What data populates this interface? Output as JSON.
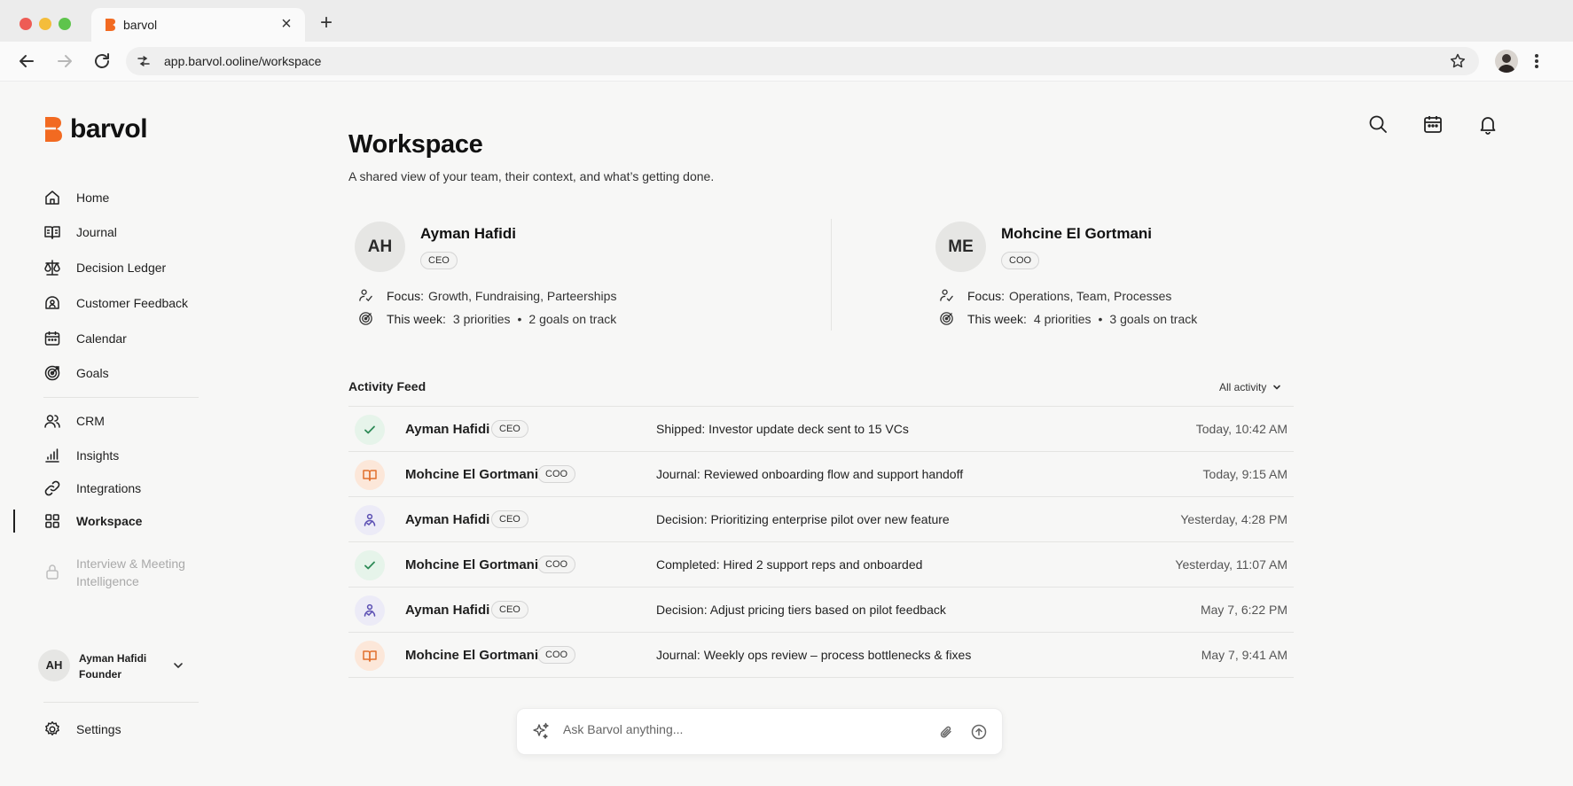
{
  "browser": {
    "tab_title": "barvol",
    "url": "app.barvol.ooline/workspace"
  },
  "brand": {
    "name": "barvol",
    "accent": "#f26a21"
  },
  "sidebar": {
    "items": [
      {
        "label": "Home",
        "icon": "home-icon"
      },
      {
        "label": "Journal",
        "icon": "book-icon"
      },
      {
        "label": "Decision Ledger",
        "icon": "scale-icon"
      },
      {
        "label": "Customer Feedback",
        "icon": "feedback-icon"
      },
      {
        "label": "Calendar",
        "icon": "calendar-icon"
      },
      {
        "label": "Goals",
        "icon": "target-icon"
      },
      {
        "label": "CRM",
        "icon": "users-icon"
      },
      {
        "label": "Insights",
        "icon": "bar-chart-icon"
      },
      {
        "label": "Integrations",
        "icon": "link-icon"
      },
      {
        "label": "Workspace",
        "icon": "grid-icon",
        "active": true
      }
    ],
    "locked_item": {
      "label_line1": "Interview & Meeting",
      "label_line2": "Intelligence",
      "icon": "lock-icon"
    },
    "user": {
      "initials": "AH",
      "name": "Ayman Hafidi",
      "role": "Founder"
    },
    "settings_label": "Settings"
  },
  "page": {
    "title": "Workspace",
    "subtitle": "A shared view of your team, their context, and what’s getting done."
  },
  "team": [
    {
      "initials": "AH",
      "name": "Ayman Hafidi",
      "role": "CEO",
      "focus_label": "Focus:",
      "focus": "Growth, Fundraising, Parteerships",
      "week_label": "This week:",
      "priorities": "3 priorities",
      "goals": "2 goals on track"
    },
    {
      "initials": "ME",
      "name": "Mohcine El Gortmani",
      "role": "COO",
      "focus_label": "Focus:",
      "focus": "Operations, Team, Processes",
      "week_label": "This week:",
      "priorities": "4 priorities",
      "goals": "3 goals on track"
    }
  ],
  "feed": {
    "title": "Activity Feed",
    "filter": "All activity",
    "rows": [
      {
        "type": "check",
        "name": "Ayman Hafidi",
        "role": "CEO",
        "text": "Shipped: Investor update deck sent to 15 VCs",
        "time": "Today, 10:42 AM"
      },
      {
        "type": "journal",
        "name": "Mohcine El Gortmani",
        "role": "COO",
        "text": "Journal: Reviewed onboarding flow and support handoff",
        "time": "Today, 9:15 AM"
      },
      {
        "type": "decision",
        "name": "Ayman Hafidi",
        "role": "CEO",
        "text": "Decision: Prioritizing enterprise pilot over new feature",
        "time": "Yesterday, 4:28 PM"
      },
      {
        "type": "check",
        "name": "Mohcine El Gortmani",
        "role": "COO",
        "text": "Completed: Hired 2 support reps and onboarded",
        "time": "Yesterday, 11:07 AM"
      },
      {
        "type": "decision",
        "name": "Ayman Hafidi",
        "role": "CEO",
        "text": "Decision: Adjust pricing tiers based on pilot feedback",
        "time": "May 7, 6:22 PM"
      },
      {
        "type": "journal",
        "name": "Mohcine El Gortmani",
        "role": "COO",
        "text": "Journal: Weekly ops review – process bottlenecks & fixes",
        "time": "May 7, 9:41 AM"
      }
    ]
  },
  "ask": {
    "placeholder": "Ask Barvol anything..."
  }
}
